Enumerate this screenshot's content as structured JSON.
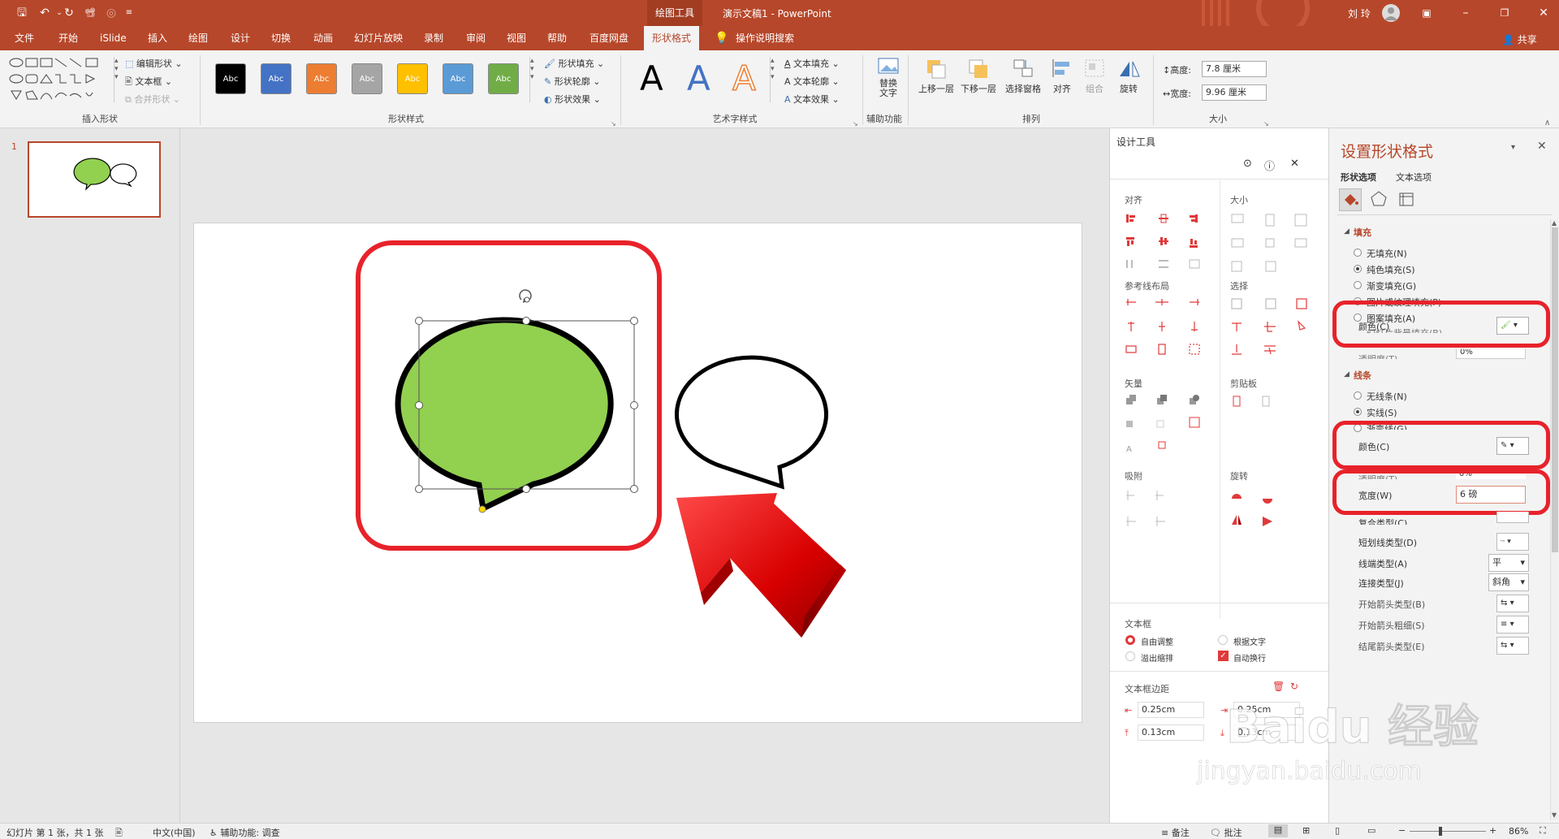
{
  "titlebar": {
    "context_group": "绘图工具",
    "document_title": "演示文稿1  -  PowerPoint",
    "user": "刘 玲",
    "share": "共享"
  },
  "tabs": [
    "文件",
    "开始",
    "iSlide",
    "插入",
    "绘图",
    "设计",
    "切换",
    "动画",
    "幻灯片放映",
    "录制",
    "审阅",
    "视图",
    "帮助",
    "百度网盘",
    "形状格式"
  ],
  "tell_me": "操作说明搜索",
  "ribbon": {
    "insert_shapes": {
      "edit_shape": "编辑形状",
      "text_box": "文本框",
      "merge_shapes": "合并形状",
      "label": "插入形状"
    },
    "shape_styles": {
      "swatches": [
        {
          "text": "Abc",
          "color": "#000000"
        },
        {
          "text": "Abc",
          "color": "#4472c4"
        },
        {
          "text": "Abc",
          "color": "#ed7d31"
        },
        {
          "text": "Abc",
          "color": "#a5a5a5"
        },
        {
          "text": "Abc",
          "color": "#ffc000"
        },
        {
          "text": "Abc",
          "color": "#5b9bd5"
        },
        {
          "text": "Abc",
          "color": "#70ad47"
        }
      ],
      "fill": "形状填充",
      "outline": "形状轮廓",
      "effects": "形状效果",
      "label": "形状样式"
    },
    "wordart": {
      "letter": "A",
      "text_fill": "文本填充",
      "text_outline": "文本轮廓",
      "text_effects": "文本效果",
      "label": "艺术字样式"
    },
    "accessibility": {
      "alt_text": "替换文字",
      "label": "辅助功能"
    },
    "arrange": {
      "bring_forward": "上移一层",
      "send_backward": "下移一层",
      "selection_pane": "选择窗格",
      "align": "对齐",
      "group": "组合",
      "rotate": "旋转",
      "label": "排列"
    },
    "size": {
      "height_label": "高度:",
      "height": "7.8 厘米",
      "width_label": "宽度:",
      "width": "9.96 厘米",
      "label": "大小"
    }
  },
  "thumbnail": {
    "number": "1"
  },
  "design_tools": {
    "title": "设计工具",
    "sections": {
      "align": "对齐",
      "size": "大小",
      "guides": "参考线布局",
      "select": "选择",
      "vector": "矢量",
      "clipboard": "剪贴板",
      "snap": "吸附",
      "rotate": "旋转"
    },
    "textbox": {
      "title": "文本框",
      "auto_adjust": "自由调整",
      "fit_text": "根据文字",
      "overflow": "溢出缩排",
      "wrap": "自动换行"
    },
    "margins": {
      "title": "文本框边距",
      "left": "0.25cm",
      "right": "0.25cm",
      "top": "0.13cm",
      "bottom": "0.13cm"
    }
  },
  "format_pane": {
    "title": "设置形状格式",
    "tab_shape": "形状选项",
    "tab_text": "文本选项",
    "fill_header": "填充",
    "fill_options": [
      "无填充(N)",
      "纯色填充(S)",
      "渐变填充(G)",
      "图片或纹理填充(P)",
      "图案填充(A)",
      "幻灯片背景填充(B)"
    ],
    "fill_color_label": "颜色(C)",
    "fill_transparency": "透明度(T)",
    "fill_transparency_value": "0%",
    "line_header": "线条",
    "line_options": [
      "无线条(N)",
      "实线(S)",
      "渐变线(G)"
    ],
    "line_color_label": "颜色(C)",
    "line_transparency": "透明度(T)",
    "line_transparency_value": "0%",
    "width_label": "宽度(W)",
    "width_value": "6 磅",
    "compound_label": "复合类型(C)",
    "dash_label": "短划线类型(D)",
    "cap_label": "线端类型(A)",
    "cap_value": "平",
    "join_label": "连接类型(J)",
    "join_value": "斜角",
    "begin_arrow_type": "开始箭头类型(B)",
    "begin_arrow_size": "开始箭头粗细(S)",
    "end_arrow_type": "结尾箭头类型(E)"
  },
  "watermark": {
    "brand": "Baidu 经验",
    "url": "jingyan.baidu.com"
  },
  "statusbar": {
    "slide_info": "幻灯片 第 1 张，共 1 张",
    "language": "中文(中国)",
    "accessibility": "辅助功能: 调查",
    "notes": "备注",
    "comments": "批注",
    "zoom": "86%"
  },
  "colors": {
    "accent": "#b7472a",
    "speech_fill": "#92d050",
    "highlight": "#e8222a"
  }
}
